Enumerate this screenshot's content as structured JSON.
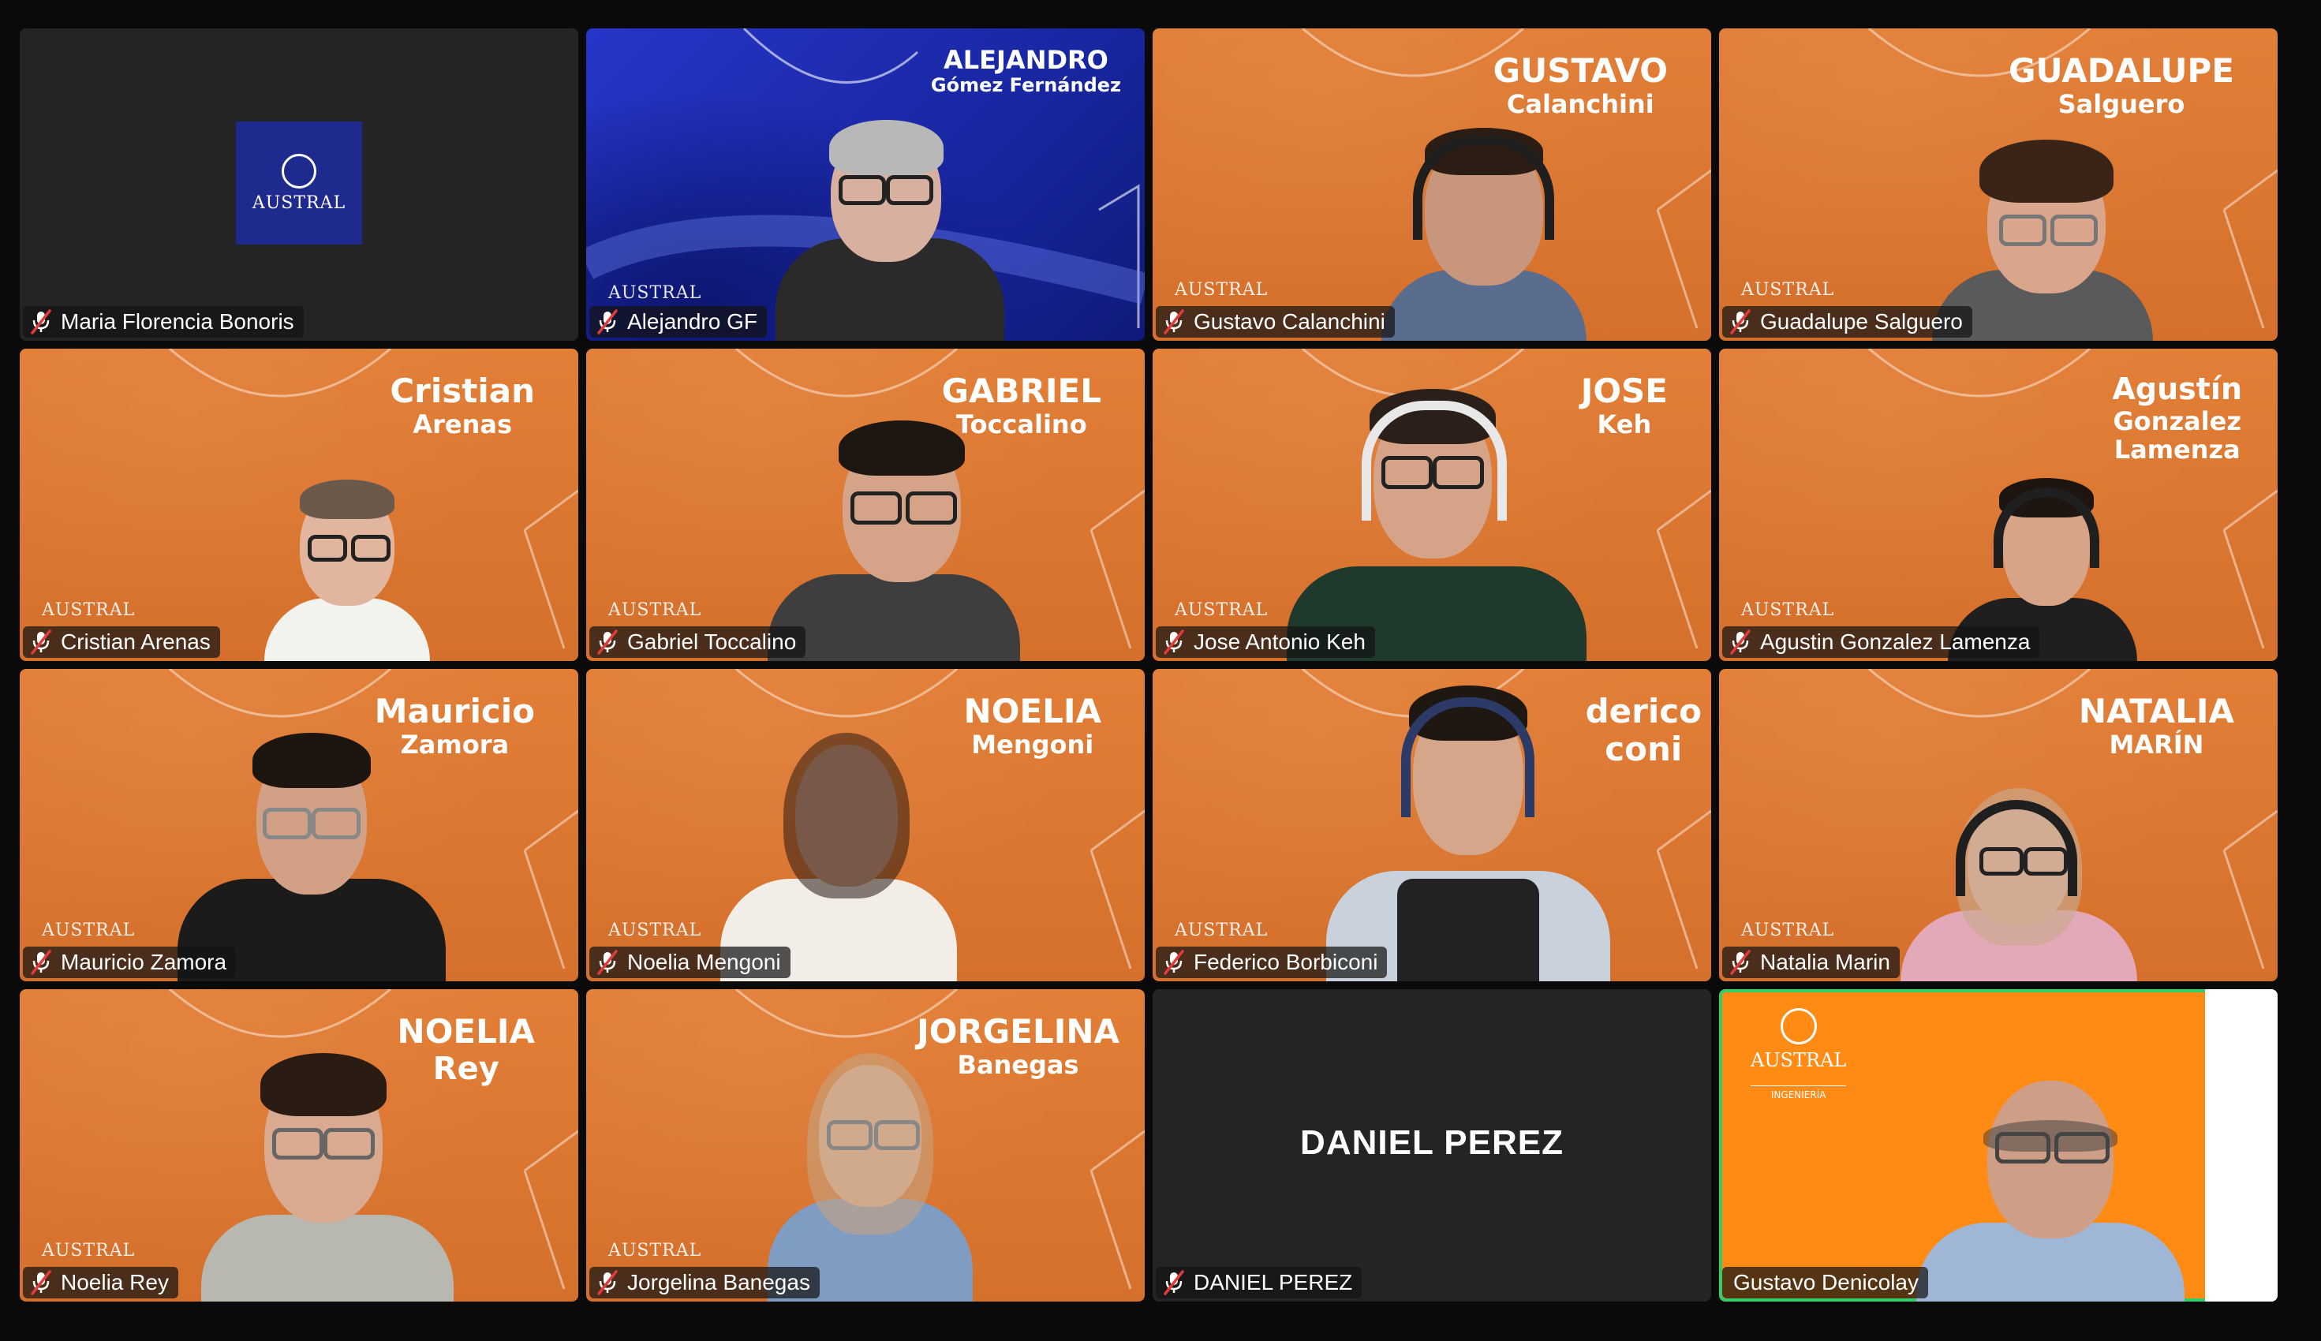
{
  "meeting": {
    "tiles": [
      {
        "id": "maria",
        "display_name": "Maria Florencia Bonoris",
        "background": "logo",
        "logo_text": "AUSTRAL",
        "muted": true
      },
      {
        "id": "alejandro",
        "display_name": "Alejandro GF",
        "background": "blue",
        "banner_line1": "ALEJANDRO",
        "banner_line2": "Gómez Fernández",
        "muted": true
      },
      {
        "id": "gustavo-c",
        "display_name": "Gustavo Calanchini",
        "background": "orange",
        "banner_line1": "GUSTAVO",
        "banner_line2": "Calanchini",
        "muted": true
      },
      {
        "id": "guadalupe",
        "display_name": "Guadalupe Salguero",
        "background": "orange",
        "banner_line1": "GUADALUPE",
        "banner_line2": "Salguero",
        "muted": true
      },
      {
        "id": "cristian",
        "display_name": "Cristian Arenas",
        "background": "orange",
        "banner_line1": "Cristian",
        "banner_line2": "Arenas",
        "muted": true
      },
      {
        "id": "gabriel",
        "display_name": "Gabriel Toccalino",
        "background": "orange",
        "banner_line1": "GABRIEL",
        "banner_line2": "Toccalino",
        "muted": true
      },
      {
        "id": "jose",
        "display_name": "Jose Antonio Keh",
        "background": "orange",
        "banner_line1": "JOSE",
        "banner_line2": "Keh",
        "muted": true
      },
      {
        "id": "agustin",
        "display_name": "Agustin Gonzalez Lamenza",
        "background": "orange",
        "banner_line1": "Agustín",
        "banner_line2": "Gonzalez",
        "banner_line3": "Lamenza",
        "muted": true
      },
      {
        "id": "mauricio",
        "display_name": "Mauricio Zamora",
        "background": "orange",
        "banner_line1": "Mauricio",
        "banner_line2": "Zamora",
        "muted": true
      },
      {
        "id": "noelia-m",
        "display_name": "Noelia Mengoni",
        "background": "orange",
        "banner_line1": "NOELIA",
        "banner_line2": "Mengoni",
        "muted": true
      },
      {
        "id": "federico",
        "display_name": "Federico Borbiconi",
        "background": "orange",
        "banner_line1": "derico",
        "banner_line2": "coni",
        "muted": true
      },
      {
        "id": "natalia",
        "display_name": "Natalia Marin",
        "background": "orange",
        "banner_line1": "NATALIA",
        "banner_line2": "MARÍN",
        "muted": true
      },
      {
        "id": "noelia-r",
        "display_name": "Noelia Rey",
        "background": "orange",
        "banner_line1": "NOELIA",
        "banner_line2": "Rey",
        "muted": true
      },
      {
        "id": "jorgelina",
        "display_name": "Jorgelina Banegas",
        "background": "orange",
        "banner_line1": "JORGELINA",
        "banner_line2": "Banegas",
        "muted": true
      },
      {
        "id": "daniel",
        "display_name": "DANIEL PEREZ",
        "background": "dark",
        "center_label": "DANIEL PEREZ",
        "muted": true
      },
      {
        "id": "gustavo-d",
        "display_name": "Gustavo Denicolay",
        "background": "bright",
        "logo_text": "AUSTRAL",
        "logo_sub": "INGENIERÍA",
        "muted": false,
        "active_speaker": true
      }
    ],
    "watermark_text": "AUSTRAL"
  },
  "colors": {
    "tile_orange": "#df7a33",
    "tile_blue": "#1b2bb0",
    "tile_dark": "#242424",
    "tile_bright": "#ff8a14",
    "active_border": "#2fd069",
    "muted_icon": "#e23b3b"
  }
}
